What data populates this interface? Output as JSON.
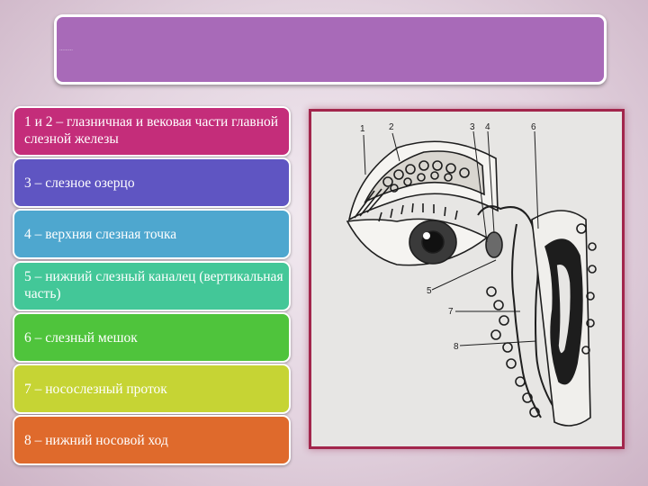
{
  "title": {
    "text": "………"
  },
  "items": [
    {
      "label": "1 и 2 – глазничная и вековая части главной слезной железы",
      "color": "#c42d7a"
    },
    {
      "label": "3 – слезное озерцо",
      "color": "#5f55c2"
    },
    {
      "label": "4 – верхняя слезная точка",
      "color": "#4ea7cf"
    },
    {
      "label": "5 – нижний слезный каналец (вертикальная часть)",
      "color": "#43c798"
    },
    {
      "label": "6 – слезный мешок",
      "color": "#4fc43c"
    },
    {
      "label": "7 – носослезный проток",
      "color": "#c6d434"
    },
    {
      "label": "8 – нижний носовой ход",
      "color": "#df6a2c"
    }
  ],
  "figure": {
    "callouts": [
      "1",
      "2",
      "3",
      "4",
      "5",
      "6",
      "7",
      "8"
    ]
  }
}
